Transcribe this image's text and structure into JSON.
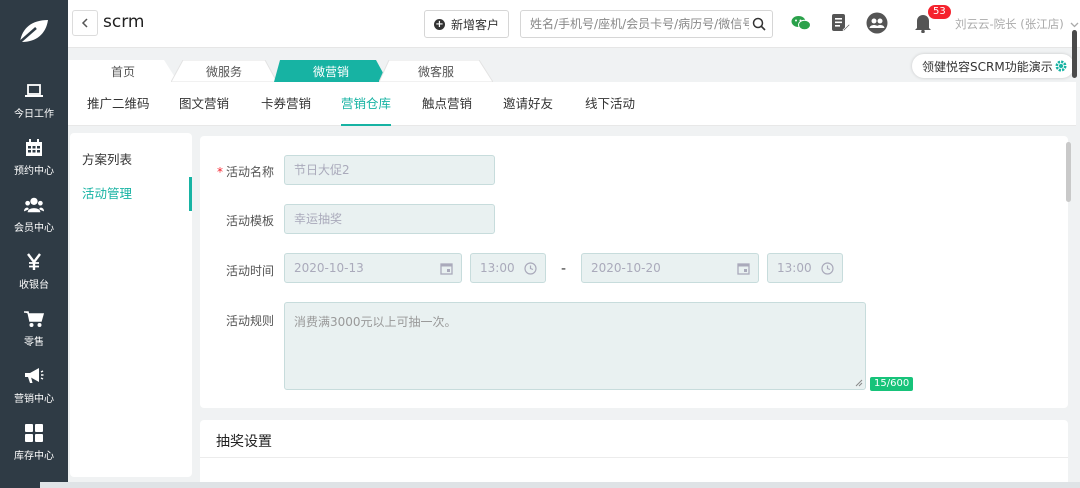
{
  "sidebar": {
    "items": [
      {
        "label": "今日工作",
        "icon": "laptop-icon"
      },
      {
        "label": "预约中心",
        "icon": "calendar-icon"
      },
      {
        "label": "会员中心",
        "icon": "members-icon"
      },
      {
        "label": "收银台",
        "icon": "yen-icon"
      },
      {
        "label": "零售",
        "icon": "cart-icon"
      },
      {
        "label": "营销中心",
        "icon": "megaphone-icon"
      },
      {
        "label": "库存中心",
        "icon": "grid-icon"
      }
    ]
  },
  "header": {
    "title": "scrm",
    "add_customer_label": "新增客户",
    "search_placeholder": "姓名/手机号/座机/会员卡号/病历号/微信号",
    "notification_count": "53",
    "user_name": "刘云云-院长 (张江店)"
  },
  "tabs": [
    {
      "label": "首页",
      "active": false
    },
    {
      "label": "微服务",
      "active": false
    },
    {
      "label": "微营销",
      "active": true
    },
    {
      "label": "微客服",
      "active": false
    }
  ],
  "demo_label": "领健悦容SCRM功能演示",
  "subnav": [
    "推广二维码",
    "图文营销",
    "卡券营销",
    "营销仓库",
    "触点营销",
    "邀请好友",
    "线下活动"
  ],
  "subnav_active": "营销仓库",
  "sidemenu": [
    "方案列表",
    "活动管理"
  ],
  "form": {
    "name_label": "活动名称",
    "name_value": "节日大促2",
    "template_label": "活动模板",
    "template_value": "幸运抽奖",
    "time_label": "活动时间",
    "start_date": "2020-10-13",
    "start_time": "13:00",
    "separator": "-",
    "end_date": "2020-10-20",
    "end_time": "13:00",
    "rules_label": "活动规则",
    "rules_value": "消费满3000元以上可抽一次。",
    "rules_counter": "15/600"
  },
  "lottery": {
    "title": "抽奖设置"
  },
  "colors": {
    "accent": "#17b3a3",
    "sidebar_bg": "#2f3b45",
    "badge": "#f5222d",
    "counter": "#17c37a"
  }
}
